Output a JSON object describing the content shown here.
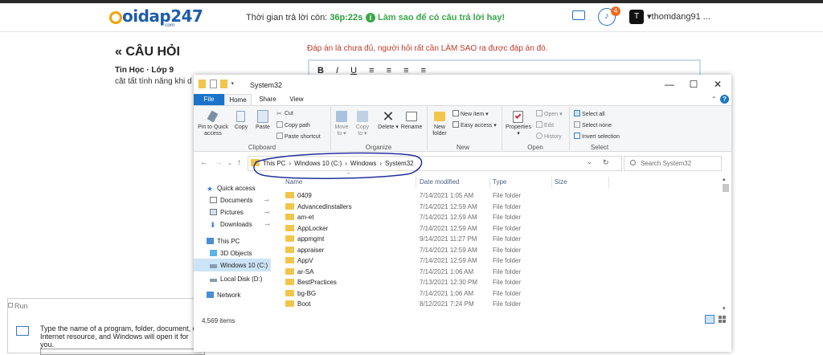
{
  "site": {
    "logo_text": "oidap247",
    "logo_sub": ".com",
    "timer_label": "Thời gian trả lời còn:",
    "timer_value": "36p:22s",
    "tip": "Làm sao để có câu trả lời hay!",
    "notification_count": "4",
    "username": "thomdang91 ...",
    "colors": {
      "brand": "#1f5da8",
      "accent": "#f0a30a",
      "tip": "#3aa84a",
      "hint": "#c0392b",
      "badge": "#ee6a1f"
    }
  },
  "page": {
    "heading": "« CÂU HỎI",
    "grade": "Tin Học · Lớp 9",
    "question_snippet": "cắt tất tính năng khi d",
    "answer_hint": "Đáp án là chưa đủ, người hỏi rất cần LÀM SAO ra được đáp án đó.",
    "editor_tools": [
      "B",
      "I",
      "U",
      "≡",
      "≡",
      "≡",
      "≡"
    ]
  },
  "run_dialog": {
    "title": "Run",
    "text": "Type the name of a program, folder, document, or Internet resource, and Windows will open it for you."
  },
  "explorer": {
    "title": "System32",
    "window_controls": [
      "—",
      "☐",
      "✕"
    ],
    "tabs": [
      "File",
      "Home",
      "Share",
      "View"
    ],
    "ribbon": {
      "clipboard": {
        "label": "Clipboard",
        "pin": "Pin to Quick access",
        "copy": "Copy",
        "paste": "Paste",
        "cut": "Cut",
        "copy_path": "Copy path",
        "paste_shortcut": "Paste shortcut"
      },
      "organize": {
        "label": "Organize",
        "move": "Move to ▾",
        "copy": "Copy to ▾",
        "delete": "Delete ▾",
        "rename": "Rename"
      },
      "new": {
        "label": "New",
        "new_folder": "New folder",
        "new_item": "New item ▾",
        "easy_access": "Easy access ▾"
      },
      "open": {
        "label": "Open",
        "properties": "Properties ▾",
        "open": "Open ▾",
        "edit": "Edit",
        "history": "History"
      },
      "select": {
        "label": "Select",
        "select_all": "Select all",
        "select_none": "Select none",
        "invert": "Invert selection"
      }
    },
    "address": {
      "path": [
        "This PC",
        "›",
        "Windows 10 (C:)",
        "›",
        "Windows",
        "›",
        "System32"
      ],
      "search_placeholder": "Search System32"
    },
    "nav_pane": [
      "Quick access",
      "Documents",
      "Pictures",
      "Downloads",
      "This PC",
      "3D Objects",
      "Windows 10 (C:)",
      "Local Disk (D:)",
      "Network"
    ],
    "columns": [
      "Name",
      "Date modified",
      "Type",
      "Size"
    ],
    "rows": [
      {
        "name": "0409",
        "date": "7/14/2021 1:05 AM",
        "type": "File folder"
      },
      {
        "name": "AdvancedInstallers",
        "date": "7/14/2021 12:59 AM",
        "type": "File folder"
      },
      {
        "name": "am-et",
        "date": "7/14/2021 12:59 AM",
        "type": "File folder"
      },
      {
        "name": "AppLocker",
        "date": "7/14/2021 12:59 AM",
        "type": "File folder"
      },
      {
        "name": "appmgmt",
        "date": "9/14/2021 11:27 PM",
        "type": "File folder"
      },
      {
        "name": "appraiser",
        "date": "7/14/2021 12:59 AM",
        "type": "File folder"
      },
      {
        "name": "AppV",
        "date": "7/14/2021 12:59 AM",
        "type": "File folder"
      },
      {
        "name": "ar-SA",
        "date": "7/14/2021 1:06 AM",
        "type": "File folder"
      },
      {
        "name": "BestPractices",
        "date": "7/13/2021 12:30 PM",
        "type": "File folder"
      },
      {
        "name": "bg-BG",
        "date": "7/14/2021 1:06 AM",
        "type": "File folder"
      },
      {
        "name": "Boot",
        "date": "8/12/2021 7:24 PM",
        "type": "File folder"
      }
    ],
    "status": "4,569 items"
  }
}
